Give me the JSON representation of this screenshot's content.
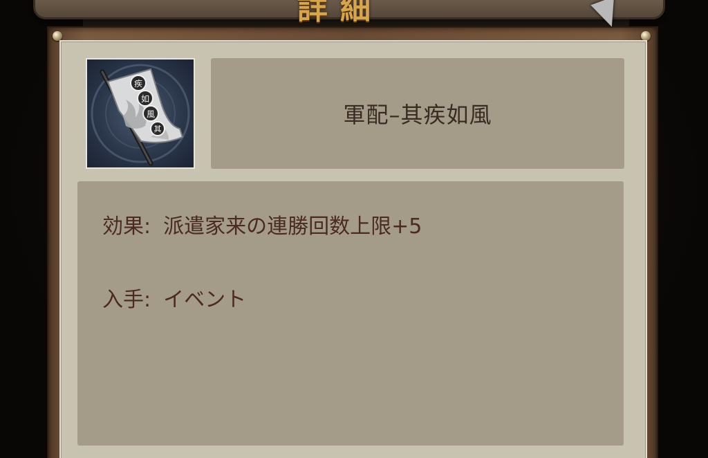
{
  "header": {
    "title_glyphs": "詳細"
  },
  "item": {
    "icon": "war-banner-icon",
    "icon_text": [
      "疾",
      "如",
      "風",
      "其"
    ],
    "name": "軍配–其疾如風"
  },
  "details": {
    "effect_label": "効果:",
    "effect_value": "派遣家来の連勝回数上限+5",
    "source_label": "入手:",
    "source_value": "イベント"
  },
  "colors": {
    "panel": "#c8c2b1",
    "box": "#a49c89",
    "text": "#4a2a22",
    "frame": "#6a4b34",
    "title_gold": "#d6a550"
  }
}
